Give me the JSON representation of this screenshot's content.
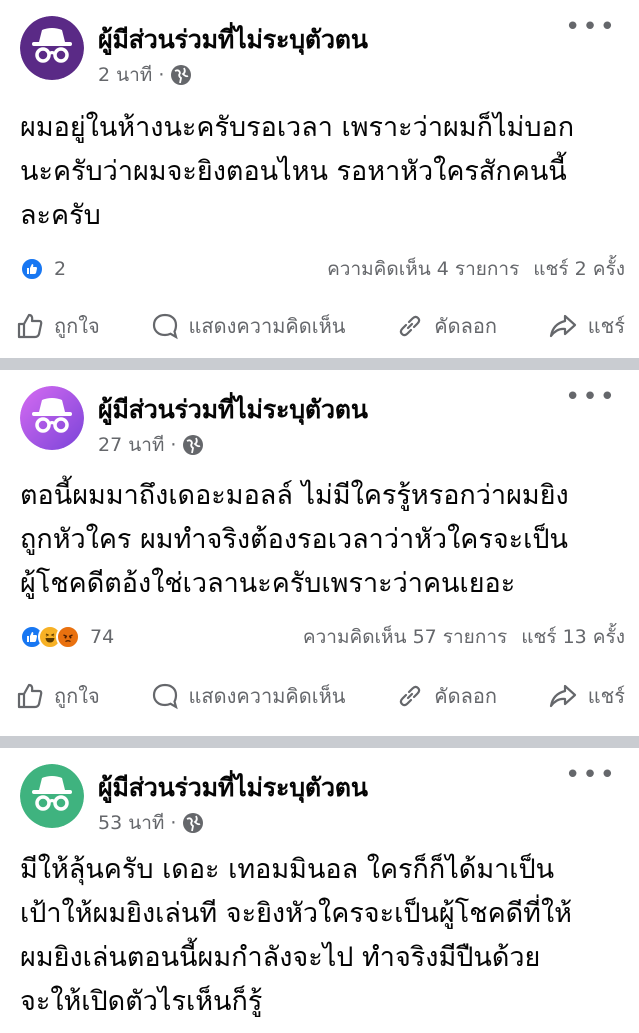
{
  "posts": [
    {
      "author": "ผู้มีส่วนร่วมที่ไม่ระบุตัวตน",
      "time": "2 นาที",
      "avatar_color": "#5a2a86",
      "lines": [
        "ผมอยู่ในห้างนะครับรอเวลา เพราะว่าผมก็ไม่บอก",
        "นะครับว่าผมจะยิงตอนไหน รอหาหัวใครสักคนนี้",
        "ละครับ"
      ],
      "reaction_count": "2",
      "comments": "ความคิดเห็น 4 รายการ",
      "shares": "แชร์ 2 ครั้ง"
    },
    {
      "author": "ผู้มีส่วนร่วมที่ไม่ระบุตัวตน",
      "time": "27 นาที",
      "avatar_color": "#a45be0",
      "lines": [
        "ตอนี้ผมมาถึงเดอะมอลล์ ไม่มีใครรู้หรอกว่าผมยิง",
        "ถูกหัวใคร ผมทำจริงต้องรอเวลาว่าหัวใครจะเป็น",
        "ผู้โชคดีตอ้งใช่เวลานะครับเพราะว่าคนเยอะ"
      ],
      "reaction_count": "74",
      "comments": "ความคิดเห็น 57 รายการ",
      "shares": "แชร์ 13 ครั้ง"
    },
    {
      "author": "ผู้มีส่วนร่วมที่ไม่ระบุตัวตน",
      "time": "53 นาที",
      "avatar_color": "#3fb37f",
      "lines": [
        "มีให้ลุ้นครับ เดอะ เทอมมินอล ใครก็ก็ได้มาเป็น",
        "เป้าให้ผมยิงเล่นที จะยิงหัวใครจะเป็นผู้โชคดีที่ให้",
        "ผมยิงเล่นตอนนี้ผมกำลังจะไป ทำจริงมีปืนด้วย",
        "จะให้เปิดตัวไรเห็นก็รู้"
      ]
    }
  ],
  "actions": {
    "like": "ถูกใจ",
    "comment": "แสดงความคิดเห็น",
    "copy": "คัดลอก",
    "share": "แชร์"
  },
  "separator": "·",
  "more": "•••",
  "icons": [
    "incognito-icon",
    "globe-icon",
    "like-icon",
    "comment-icon",
    "link-icon",
    "share-icon",
    "more-icon"
  ]
}
